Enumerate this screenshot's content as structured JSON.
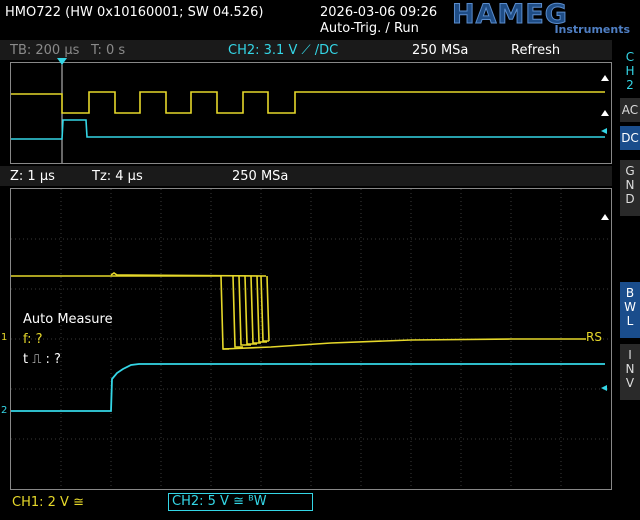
{
  "header": {
    "device": "HMO722 (HW 0x10160001; SW 04.526)",
    "datetime": "2026-03-06 09:26",
    "trigger_state": "Auto-Trig. / Run",
    "brand": "HAMEG",
    "brand_sub": "Instruments"
  },
  "status": {
    "timebase": "TB: 200 µs",
    "time_offset": "T: 0 s",
    "channel_setting": "CH2: 3.1 V ⟋ /DC",
    "sample_rate": "250 MSa",
    "mode": "Refresh"
  },
  "zoom": {
    "zoom": "Z: 1 µs",
    "zoom_offset": "Tz: 4 µs",
    "sample_rate": "250 MSa"
  },
  "measure": {
    "title": "Auto Measure",
    "freq": "f: ?",
    "pulse_width": "t ⎍ : ?"
  },
  "markers": {
    "ch1": "1",
    "ch2": "2",
    "rs": "RS"
  },
  "side": {
    "channel_tab": [
      "C",
      "H",
      "2"
    ],
    "ac": "AC",
    "dc": "DC",
    "gnd": [
      "G",
      "N",
      "D"
    ],
    "bwl": [
      "B",
      "W",
      "L"
    ],
    "inv": [
      "I",
      "N",
      "V"
    ]
  },
  "bottom": {
    "ch1": "CH1: 2 V ≅",
    "ch2": "CH2: 5 V ≅ ᴮW"
  },
  "colors": {
    "ch1": "#e6d82a",
    "ch2": "#34d6e6",
    "accent": "#1a4d8c"
  }
}
